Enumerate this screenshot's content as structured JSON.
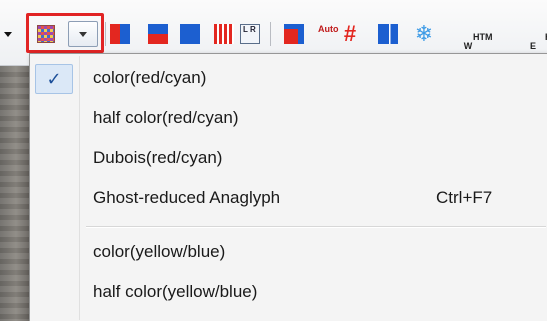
{
  "toolbar": {
    "buttons": [
      {
        "name": "anaglyph-mode",
        "icon": "pixel-grid-icon"
      },
      {
        "name": "anaglyph-dropdown",
        "icon": "chevron-down-icon"
      },
      {
        "name": "half-split",
        "icon": "red-blue-vertical-icon"
      },
      {
        "name": "half-horizontal",
        "icon": "red-blue-horizontal-icon"
      },
      {
        "name": "blue-block",
        "icon": "blue-block-icon"
      },
      {
        "name": "interlace",
        "icon": "stripes-icon"
      },
      {
        "name": "document",
        "icon": "document-icon"
      },
      {
        "name": "overlap",
        "icon": "overlap-icon"
      },
      {
        "name": "auto-align",
        "icon": "auto-icon"
      },
      {
        "name": "hash",
        "icon": "hash-icon"
      },
      {
        "name": "side-by-side",
        "icon": "two-bars-icon"
      },
      {
        "name": "snowflake",
        "icon": "snowflake-icon"
      },
      {
        "name": "htm-w",
        "icon": "htm-w-icon"
      },
      {
        "name": "htm-e",
        "icon": "htm-e-icon"
      }
    ],
    "auto_label": "Auto",
    "doc_label": "L R",
    "htm_w_label": "HTM\nW",
    "htm_e_label": "HT\nE"
  },
  "menu": {
    "items": [
      {
        "label": "color(red/cyan)",
        "checked": true,
        "shortcut": ""
      },
      {
        "label": "half color(red/cyan)",
        "checked": false,
        "shortcut": ""
      },
      {
        "label": "Dubois(red/cyan)",
        "checked": false,
        "shortcut": ""
      },
      {
        "label": "Ghost-reduced Anaglyph",
        "checked": false,
        "shortcut": "Ctrl+F7"
      },
      {
        "label": "color(yellow/blue)",
        "checked": false,
        "shortcut": ""
      },
      {
        "label": "half color(yellow/blue)",
        "checked": false,
        "shortcut": ""
      }
    ],
    "check_glyph": "✓"
  },
  "colors": {
    "highlight": "#e12424",
    "red": "#e32720",
    "blue": "#1c5fd0",
    "check_bg": "#dbe8f7"
  }
}
